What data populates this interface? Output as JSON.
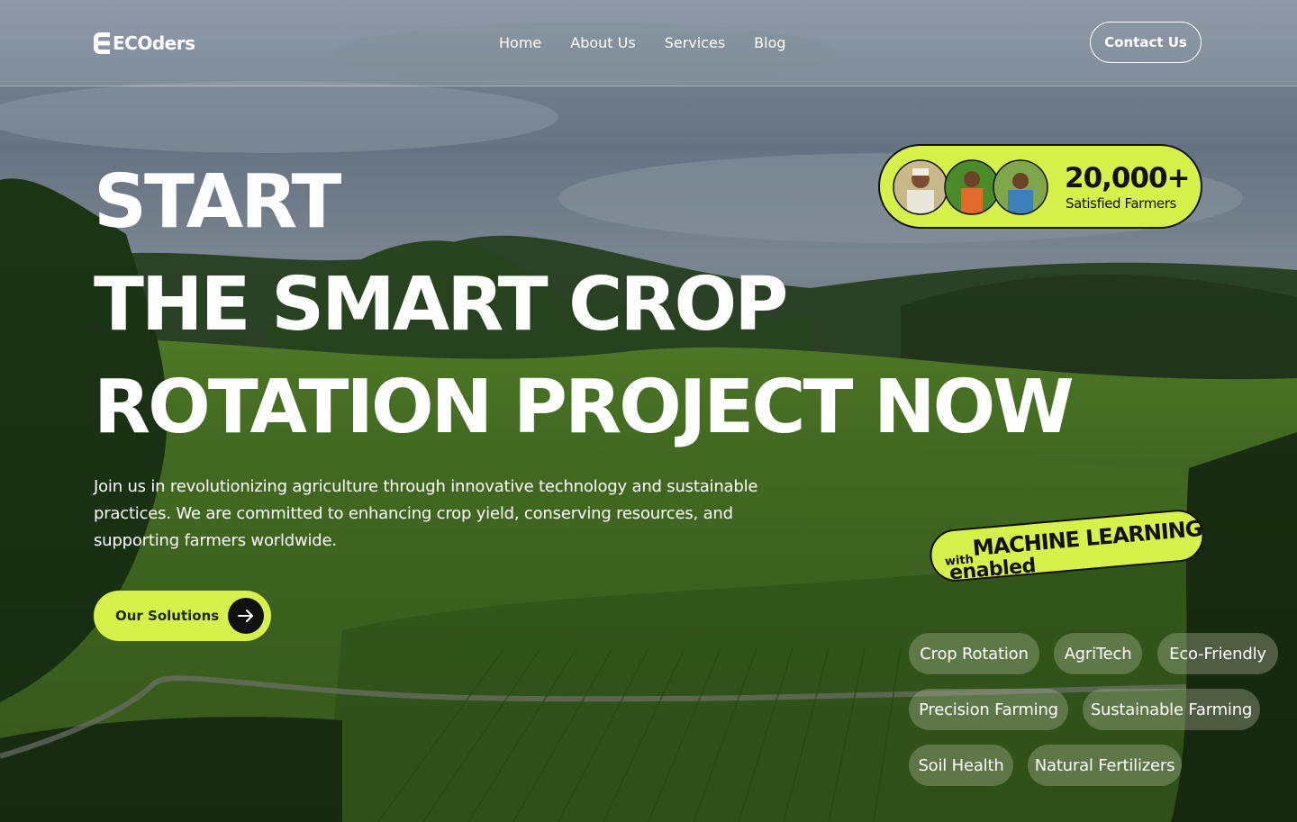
{
  "brand": {
    "name": "ECOders"
  },
  "nav": {
    "links": [
      "Home",
      "About Us",
      "Services",
      "Blog"
    ],
    "contact_label": "Contact Us"
  },
  "hero": {
    "headline_lines": [
      "START",
      "THE SMART CROP",
      "ROTATION PROJECT NOW"
    ],
    "description": "Join us in revolutionizing agriculture through innovative technology and sustainable practices. We are committed to enhancing crop yield, conserving resources, and supporting farmers worldwide.",
    "cta_label": "Our Solutions"
  },
  "farmers_badge": {
    "count": "20,000+",
    "label": "Satisfied Farmers"
  },
  "ml_badge": {
    "prefix": "with",
    "title": "MACHINE LEARNING",
    "suffix": "enabled"
  },
  "tags": [
    "Crop Rotation",
    "AgriTech",
    "Eco-Friendly",
    "Precision Farming",
    "Sustainable Farming",
    "Soil Health",
    "Natural Fertilizers"
  ],
  "colors": {
    "accent": "#d6f24a",
    "dark": "#111111",
    "tag_bg": "rgba(170,178,150,0.38)"
  },
  "icons": {
    "logo": "ecoders-logo-icon",
    "cta": "arrow-right-icon"
  }
}
